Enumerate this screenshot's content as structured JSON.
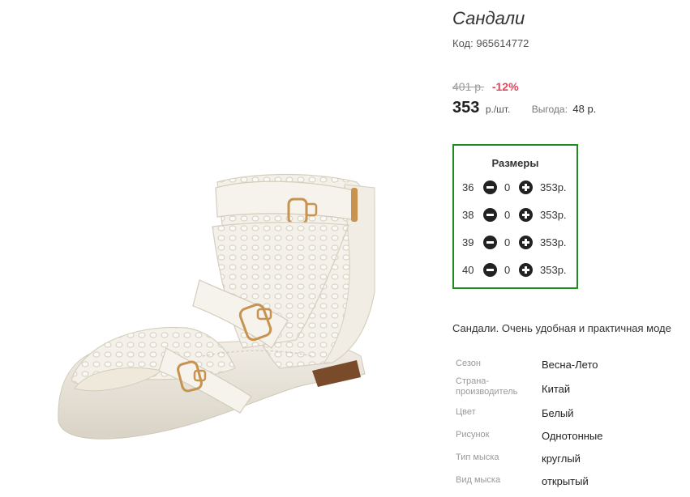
{
  "product": {
    "title": "Сандали",
    "code_label": "Код:",
    "code_value": "965614772",
    "old_price": "401 р.",
    "discount": "-12%",
    "price": "353",
    "price_unit": "р./шт.",
    "savings_label": "Выгода:",
    "savings_value": "48 р."
  },
  "sizes": {
    "title": "Размеры",
    "rows": [
      {
        "size": "36",
        "qty": "0",
        "price": "353р."
      },
      {
        "size": "38",
        "qty": "0",
        "price": "353р."
      },
      {
        "size": "39",
        "qty": "0",
        "price": "353р."
      },
      {
        "size": "40",
        "qty": "0",
        "price": "353р."
      }
    ]
  },
  "description": "Сандали. Очень удобная и практичная моде",
  "attributes": [
    {
      "label": "Сезон",
      "value": "Весна-Лето"
    },
    {
      "label": "Страна-\nпроизводитель",
      "value": "Китай"
    },
    {
      "label": "Цвет",
      "value": "Белый"
    },
    {
      "label": "Рисунок",
      "value": "Однотонные"
    },
    {
      "label": "Тип мыска",
      "value": "круглый"
    },
    {
      "label": "Вид мыска",
      "value": "открытый"
    }
  ],
  "colors": {
    "size_box_border": "#1e8c1e",
    "discount": "#e2435a",
    "old_price": "#9a9a9a"
  },
  "icons": {
    "minus": "minus-circle-icon",
    "plus": "plus-circle-icon"
  }
}
